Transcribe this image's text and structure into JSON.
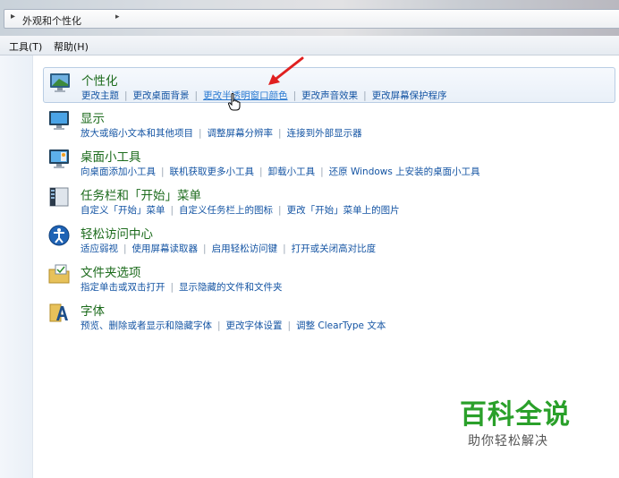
{
  "address": {
    "crumb": "外观和个性化"
  },
  "menu": [
    {
      "label": "工具(T)"
    },
    {
      "label": "帮助(H)"
    }
  ],
  "categories": [
    {
      "title": "个性化",
      "icon": "personalization-icon",
      "links": [
        "更改主题",
        "更改桌面背景",
        "更改半透明窗口颜色",
        "更改声音效果",
        "更改屏幕保护程序"
      ]
    },
    {
      "title": "显示",
      "icon": "display-icon",
      "links": [
        "放大或缩小文本和其他项目",
        "调整屏幕分辨率",
        "连接到外部显示器"
      ]
    },
    {
      "title": "桌面小工具",
      "icon": "desktop-gadgets-icon",
      "links": [
        "向桌面添加小工具",
        "联机获取更多小工具",
        "卸载小工具",
        "还原 Windows 上安装的桌面小工具"
      ]
    },
    {
      "title": "任务栏和「开始」菜单",
      "icon": "taskbar-icon",
      "links": [
        "自定义「开始」菜单",
        "自定义任务栏上的图标",
        "更改「开始」菜单上的图片"
      ]
    },
    {
      "title": "轻松访问中心",
      "icon": "ease-of-access-icon",
      "links": [
        "适应弱视",
        "使用屏幕读取器",
        "启用轻松访问键",
        "打开或关闭高对比度"
      ]
    },
    {
      "title": "文件夹选项",
      "icon": "folder-options-icon",
      "links": [
        "指定单击或双击打开",
        "显示隐藏的文件和文件夹"
      ]
    },
    {
      "title": "字体",
      "icon": "fonts-icon",
      "links": [
        "预览、删除或者显示和隐藏字体",
        "更改字体设置",
        "调整 ClearType 文本"
      ]
    }
  ],
  "watermark": {
    "main": "百科全说",
    "sub": "助你轻松解决"
  },
  "colors": {
    "title_green": "#1c6b1c",
    "link_blue": "#1454a3",
    "annotation_red": "#e02020",
    "watermark_green": "#2aa02a"
  }
}
